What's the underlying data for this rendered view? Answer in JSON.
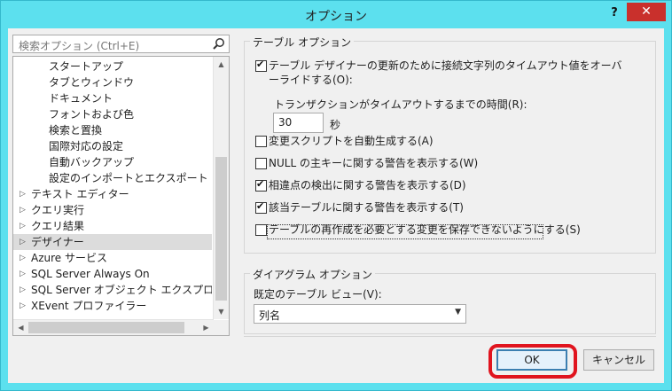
{
  "window": {
    "title": "オプション",
    "help": "?",
    "close": "✕"
  },
  "search": {
    "placeholder": "検索オプション (Ctrl+E)"
  },
  "tree": {
    "items": [
      {
        "label": "スタートアップ",
        "level": 2,
        "arrow": ""
      },
      {
        "label": "タブとウィンドウ",
        "level": 2,
        "arrow": ""
      },
      {
        "label": "ドキュメント",
        "level": 2,
        "arrow": ""
      },
      {
        "label": "フォントおよび色",
        "level": 2,
        "arrow": ""
      },
      {
        "label": "検索と置換",
        "level": 2,
        "arrow": ""
      },
      {
        "label": "国際対応の設定",
        "level": 2,
        "arrow": ""
      },
      {
        "label": "自動バックアップ",
        "level": 2,
        "arrow": ""
      },
      {
        "label": "設定のインポートとエクスポート",
        "level": 2,
        "arrow": ""
      },
      {
        "label": "テキスト エディター",
        "level": 1,
        "arrow": "▷"
      },
      {
        "label": "クエリ実行",
        "level": 1,
        "arrow": "▷"
      },
      {
        "label": "クエリ結果",
        "level": 1,
        "arrow": "▷"
      },
      {
        "label": "デザイナー",
        "level": 1,
        "arrow": "▷",
        "selected": true
      },
      {
        "label": "Azure サービス",
        "level": 1,
        "arrow": "▷"
      },
      {
        "label": "SQL Server Always On",
        "level": 1,
        "arrow": "▷"
      },
      {
        "label": "SQL Server オブジェクト エクスプローラー",
        "level": 1,
        "arrow": "▷"
      },
      {
        "label": "XEvent プロファイラー",
        "level": 1,
        "arrow": "▷"
      }
    ]
  },
  "table_options": {
    "title": "テーブル オプション",
    "timeout_cb_line1": "テーブル デザイナーの更新のために接続文字列のタイムアウト値をオーバ",
    "timeout_cb_line2": "ーライドする(O):",
    "timeout_checked": true,
    "tx_label": "トランザクションがタイムアウトするまでの時間(R):",
    "tx_value": "30",
    "tx_unit": "秒",
    "checkboxes": [
      {
        "label": "変更スクリプトを自動生成する(A)",
        "checked": false
      },
      {
        "label": "NULL の主キーに関する警告を表示する(W)",
        "checked": false
      },
      {
        "label": "相違点の検出に関する警告を表示する(D)",
        "checked": true
      },
      {
        "label": "該当テーブルに関する警告を表示する(T)",
        "checked": true
      },
      {
        "label": "テーブルの再作成を必要とする変更を保存できないようにする(S)",
        "checked": false
      }
    ]
  },
  "diagram_options": {
    "title": "ダイアグラム オプション",
    "view_label": "既定のテーブル ビュー(V):",
    "view_value": "列名"
  },
  "buttons": {
    "ok": "OK",
    "cancel": "キャンセル"
  },
  "colors": {
    "titlebar": "#5ce0ee",
    "close": "#c9302c",
    "highlight_ring": "#e0141e",
    "default_button_border": "#3c7fb1"
  }
}
